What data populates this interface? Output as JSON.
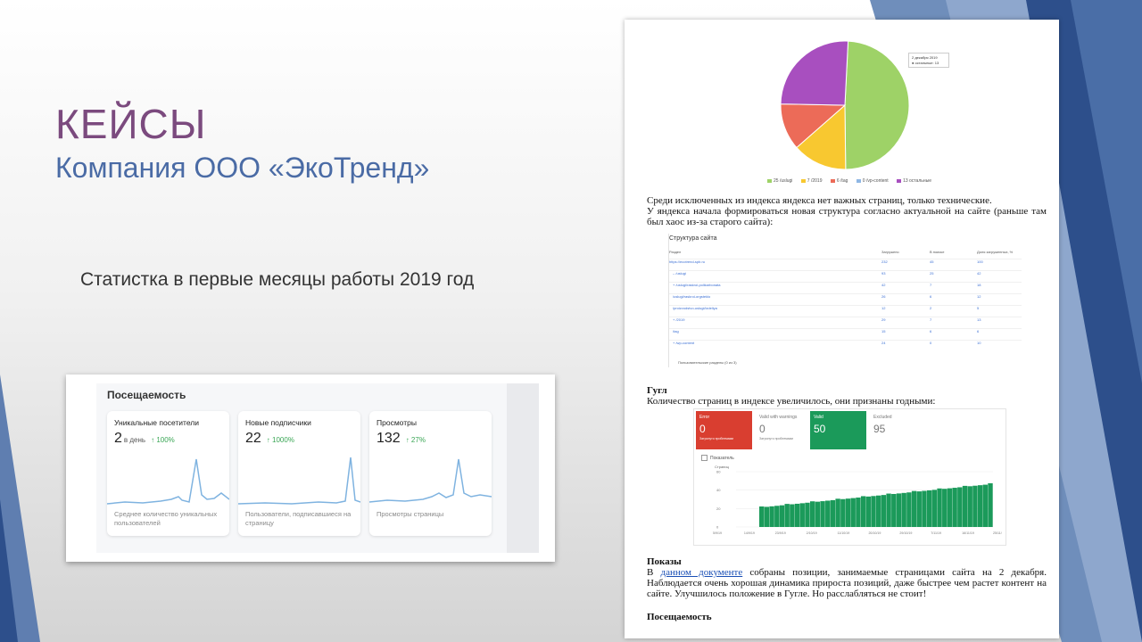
{
  "slide": {
    "title": "КЕЙСЫ",
    "subtitle": "Компания ООО «ЭкоТренд»",
    "stat_caption": "Статистка в первые месяцы работы 2019 год"
  },
  "attendance": {
    "heading": "Посещаемость",
    "metrics": [
      {
        "label": "Уникальные посетители",
        "value": "2",
        "unit": "в день",
        "change": "↑ 100%",
        "desc": "Среднее количество уникальных пользователей"
      },
      {
        "label": "Новые подписчики",
        "value": "22",
        "unit": "",
        "change": "↑ 1000%",
        "desc": "Пользователи, подписавшиеся на страницу"
      },
      {
        "label": "Просмотры",
        "value": "132",
        "unit": "",
        "change": "↑ 27%",
        "desc": "Просмотры страницы"
      }
    ]
  },
  "document": {
    "pie_tooltip": {
      "line1": "2 декабря 2019",
      "line2": "● остальные: 13"
    },
    "pie_legend": [
      {
        "label": "25 /uslugi",
        "color": "#9ed267"
      },
      {
        "label": "7 /2019",
        "color": "#f8c830"
      },
      {
        "label": "6 /tag",
        "color": "#ec6b58"
      },
      {
        "label": "0 /vp-content",
        "color": "#8fb7e4"
      },
      {
        "label": "13 остальные",
        "color": "#a84fbf"
      }
    ],
    "para1_line1": "Среди исключенных из индекса яндекса нет важных страниц, только технические.",
    "para1_rest": "У яндекса начала формироваться новая структура согласно актуальной на сайте (раньше там был хаос из-за старого сайта):",
    "structure": {
      "title": "Структура сайта",
      "head_section": "Раздел",
      "head_loaded": "Загружено",
      "head_search": "В поиске",
      "head_share": "Доля загруженных, %",
      "rows": [
        {
          "name": "https://ecotrend-spb.ru",
          "a": "232",
          "b": "45",
          "c": "100"
        },
        {
          "name": "– /uslugi",
          "a": "93",
          "b": "25",
          "c": "42"
        },
        {
          "name": "+ /uslugi/raskroi-polikarbonata",
          "a": "42",
          "b": "7",
          "c": "18"
        },
        {
          "name": "/uslugi/raskroi-orgsteklo",
          "a": "26",
          "b": "6",
          "c": "12"
        },
        {
          "name": "/proizvodstvo-uslugi/izdeliya",
          "a": "12",
          "b": "2",
          "c": "5"
        },
        {
          "name": "+ /2019",
          "a": "29",
          "b": "7",
          "c": "13"
        },
        {
          "name": "/tag",
          "a": "15",
          "b": "6",
          "c": "6"
        },
        {
          "name": "+ /wp-content",
          "a": "24",
          "b": "0",
          "c": "10"
        }
      ],
      "footer": "Пользовательские разделы (0 из 3)"
    },
    "google_heading": "Гугл",
    "google_text": "Количество страниц в индексе увеличилось, они признаны годными:",
    "gsc": {
      "boxes": [
        {
          "label": "Error",
          "value": "0",
          "sub": "Затронуто проблемами",
          "bg": "#d93e30",
          "fg": "#ffffff"
        },
        {
          "label": "Valid with warnings",
          "value": "0",
          "sub": "Затронуто проблемами",
          "bg": "#ffffff",
          "fg": "#777777"
        },
        {
          "label": "Valid",
          "value": "50",
          "sub": "",
          "bg": "#1b9a5a",
          "fg": "#ffffff"
        },
        {
          "label": "Excluded",
          "value": "95",
          "sub": "",
          "bg": "#ffffff",
          "fg": "#777777"
        }
      ],
      "checkbox_label": "Показатель",
      "y_title": "Страниц",
      "y_ticks": [
        "60",
        "40",
        "20",
        "0"
      ],
      "x_ticks": [
        "5/9/19",
        "14/9/19",
        "23/9/19",
        "2/10/19",
        "11/10/19",
        "20/10/19",
        "29/10/19",
        "7/11/19",
        "16/11/19",
        "25/11/19"
      ]
    },
    "shows_heading": "Показы",
    "shows_pre": "В ",
    "shows_link": "данном документе",
    "shows_post": " собраны позиции, занимаемые страницами сайта на 2 декабря. Наблюдается очень хорошая динамика прироста позиций, даже быстрее чем растет контент на сайте. Улучшилось положение в Гугле. Но расслабляться не стоит!",
    "attendance_heading": "Посещаемость"
  },
  "chart_data": {
    "type": "pie",
    "categories": [
      "/uslugi",
      "/2019",
      "/tag",
      "/vp-content",
      "остальные"
    ],
    "values": [
      25,
      7,
      6,
      0,
      13
    ]
  },
  "colors": {
    "title": "#7b4a7e",
    "subtitle": "#4a6ba5",
    "accent_blue": "#2d4f8b"
  }
}
